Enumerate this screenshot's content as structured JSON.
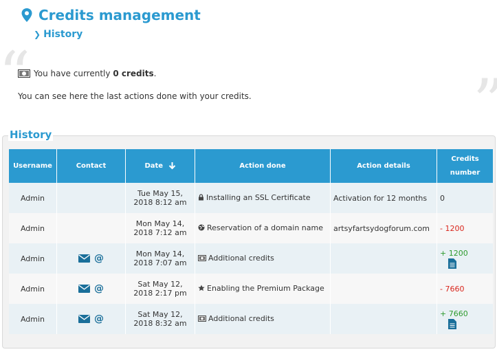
{
  "header": {
    "title": "Credits management",
    "breadcrumb": "History"
  },
  "summary": {
    "prefix": "You have currently",
    "credits_value": "0 credits",
    "suffix": ".",
    "description": "You can see here the last actions done with your credits."
  },
  "history": {
    "legend": "History",
    "columns": {
      "username": "Username",
      "contact": "Contact",
      "date": "Date",
      "action": "Action done",
      "details": "Action details",
      "credits_line1": "Credits",
      "credits_line2": "number"
    },
    "rows": [
      {
        "username": "Admin",
        "contact": false,
        "date1": "Tue May 15,",
        "date2": "2018 8:12 am",
        "action_icon": "lock-icon",
        "action": "Installing an SSL Certificate",
        "details": "Activation for 12 months",
        "credits": "0",
        "credits_class": "",
        "invoice": false
      },
      {
        "username": "Admin",
        "contact": false,
        "date1": "Mon May 14,",
        "date2": "2018 7:12 am",
        "action_icon": "globe-icon",
        "action": "Reservation of a domain name",
        "details": "artsyfartsydogforum.com",
        "credits": "- 1200",
        "credits_class": "neg",
        "invoice": false
      },
      {
        "username": "Admin",
        "contact": true,
        "date1": "Mon May 14,",
        "date2": "2018 7:07 am",
        "action_icon": "money-icon",
        "action": "Additional credits",
        "details": "",
        "credits": "+ 1200",
        "credits_class": "pos",
        "invoice": true
      },
      {
        "username": "Admin",
        "contact": true,
        "date1": "Sat May 12,",
        "date2": "2018 2:17 pm",
        "action_icon": "star-icon",
        "action": "Enabling the Premium Package",
        "details": "",
        "credits": "- 7660",
        "credits_class": "neg",
        "invoice": false
      },
      {
        "username": "Admin",
        "contact": true,
        "date1": "Sat May 12,",
        "date2": "2018 8:32 am",
        "action_icon": "money-icon",
        "action": "Additional credits",
        "details": "",
        "credits": "+ 7660",
        "credits_class": "pos",
        "invoice": true
      }
    ]
  },
  "colors": {
    "accent": "#2b9ad0",
    "negative": "#d9261c",
    "positive": "#2d9a2d"
  },
  "icons": [
    "map-pin-icon",
    "chevron-right-icon",
    "money-icon",
    "sort-down-icon",
    "envelope-icon",
    "at-icon",
    "lock-icon",
    "globe-icon",
    "star-icon",
    "document-icon"
  ]
}
